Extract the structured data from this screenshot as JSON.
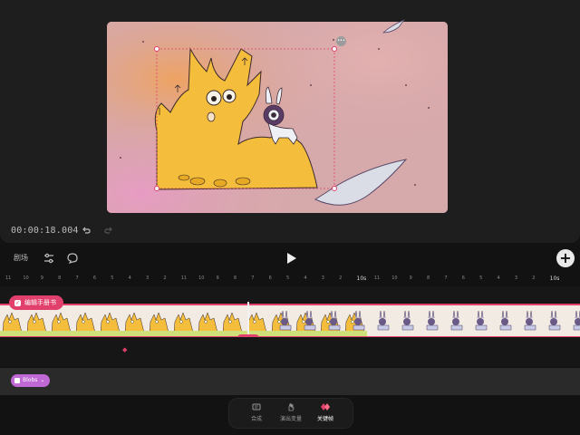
{
  "preview": {
    "timecode": "00:00:18.004",
    "menu_dots": "•••"
  },
  "toolbar": {
    "scene_label": "剧场",
    "add_label": "+"
  },
  "ruler": {
    "labels": [
      "11",
      "10",
      "9",
      "8",
      "7",
      "6",
      "5",
      "4",
      "3",
      "2",
      "11",
      "10",
      "9",
      "8",
      "7",
      "6",
      "5",
      "4",
      "3",
      "2",
      "10s",
      "11",
      "10",
      "9",
      "8",
      "7",
      "6",
      "5",
      "4",
      "3",
      "2",
      "10s"
    ]
  },
  "timeline": {
    "edit_chip_label": "编辑手册书",
    "blob_chip_label": "Blobs"
  },
  "dock": {
    "items": [
      {
        "label": "合成",
        "icon": "layers-icon"
      },
      {
        "label": "演出变量",
        "icon": "hand-icon"
      },
      {
        "label": "关键帧",
        "icon": "keyframe-icon"
      }
    ]
  },
  "colors": {
    "accent": "#e0406b",
    "canvas_bg": "#d7a7a8",
    "blob_chip": "#c069d4"
  }
}
